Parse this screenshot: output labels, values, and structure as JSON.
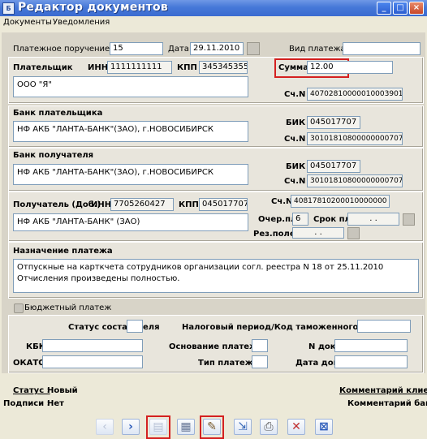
{
  "window": {
    "title": "Редактор документов",
    "icon": "document-editor-icon"
  },
  "menu": [
    "Документы",
    "Уведомления"
  ],
  "header": {
    "order_label": "Платежное поручение N",
    "order_number": "15",
    "date_label": "Дата",
    "date_value": "29.11.2010",
    "payment_kind_label": "Вид платежа",
    "payment_kind_value": ""
  },
  "payer": {
    "label": "Плательщик",
    "inn_label": "ИНН",
    "inn": "1111111111",
    "kpp_label": "КПП",
    "kpp": "345345355",
    "name": "ООО \"Я\"",
    "sum_label": "Сумма",
    "sum": "12.00",
    "account_label": "Сч.N",
    "account": "40702810000010003901"
  },
  "payer_bank": {
    "label": "Банк плательщика",
    "name": "НФ АКБ \"ЛАНТА-БАНК\"(ЗАО), г.НОВОСИБИРСК",
    "bik_label": "БИК",
    "bik": "045017707",
    "account_label": "Сч.N",
    "account": "30101810800000000707"
  },
  "payee_bank": {
    "label": "Банк получателя",
    "name": "НФ АКБ \"ЛАНТА-БАНК\"(ЗАО), г.НОВОСИБИРСК",
    "bik_label": "БИК",
    "bik": "045017707",
    "account_label": "Сч.N",
    "account": "30101810800000000707"
  },
  "payee": {
    "label": "Получатель (Доб.)",
    "inn_label": "ИНН",
    "inn": "7705260427",
    "kpp_label": "КПП",
    "kpp": "045017707",
    "name": "НФ АКБ \"ЛАНТА-БАНК\" (ЗАО)",
    "account_label": "Сч.N",
    "account": "40817810200010000000",
    "order_label": "Очер.пл",
    "order": "6",
    "term_label": "Срок пл",
    "term": ". .",
    "reserve_label": "Рез.поле",
    "reserve": ". ."
  },
  "purpose": {
    "label": "Назначение платежа",
    "text": "Отпускные на карткчета сотрудников организации согл. реестра N 18 от 25.11.2010 Отчисления произведены полностью."
  },
  "budget": {
    "checkbox_label": "Бюджетный платеж",
    "compiler_status_label": "Статус составителя",
    "compiler_status": "",
    "tax_period_label": "Налоговый период/Код таможенного органа",
    "tax_period": "",
    "kbk_label": "КБК",
    "kbk": "",
    "okato_label": "ОКАТО",
    "okato": "",
    "basis_label": "Основание платежа",
    "basis": "",
    "type_label": "Тип платежа",
    "type": "",
    "doc_number_label": "N док.",
    "doc_number": "",
    "doc_date_label": "Дата док.",
    "doc_date": ""
  },
  "footer": {
    "status_label": "Статус :",
    "status": "Новый",
    "signatures_label": "Подписи :",
    "signatures": "Нет",
    "client_comment": "Комментарий клиента",
    "bank_comment": "Комментарий банка"
  },
  "toolbar": [
    "back-icon",
    "forward-icon",
    "save-icon",
    "view-icon",
    "sign-icon",
    "send-icon",
    "print-icon",
    "delete-icon",
    "close-icon"
  ],
  "colors": {
    "title_bar": "#4678d8",
    "highlight": "#d42020"
  }
}
